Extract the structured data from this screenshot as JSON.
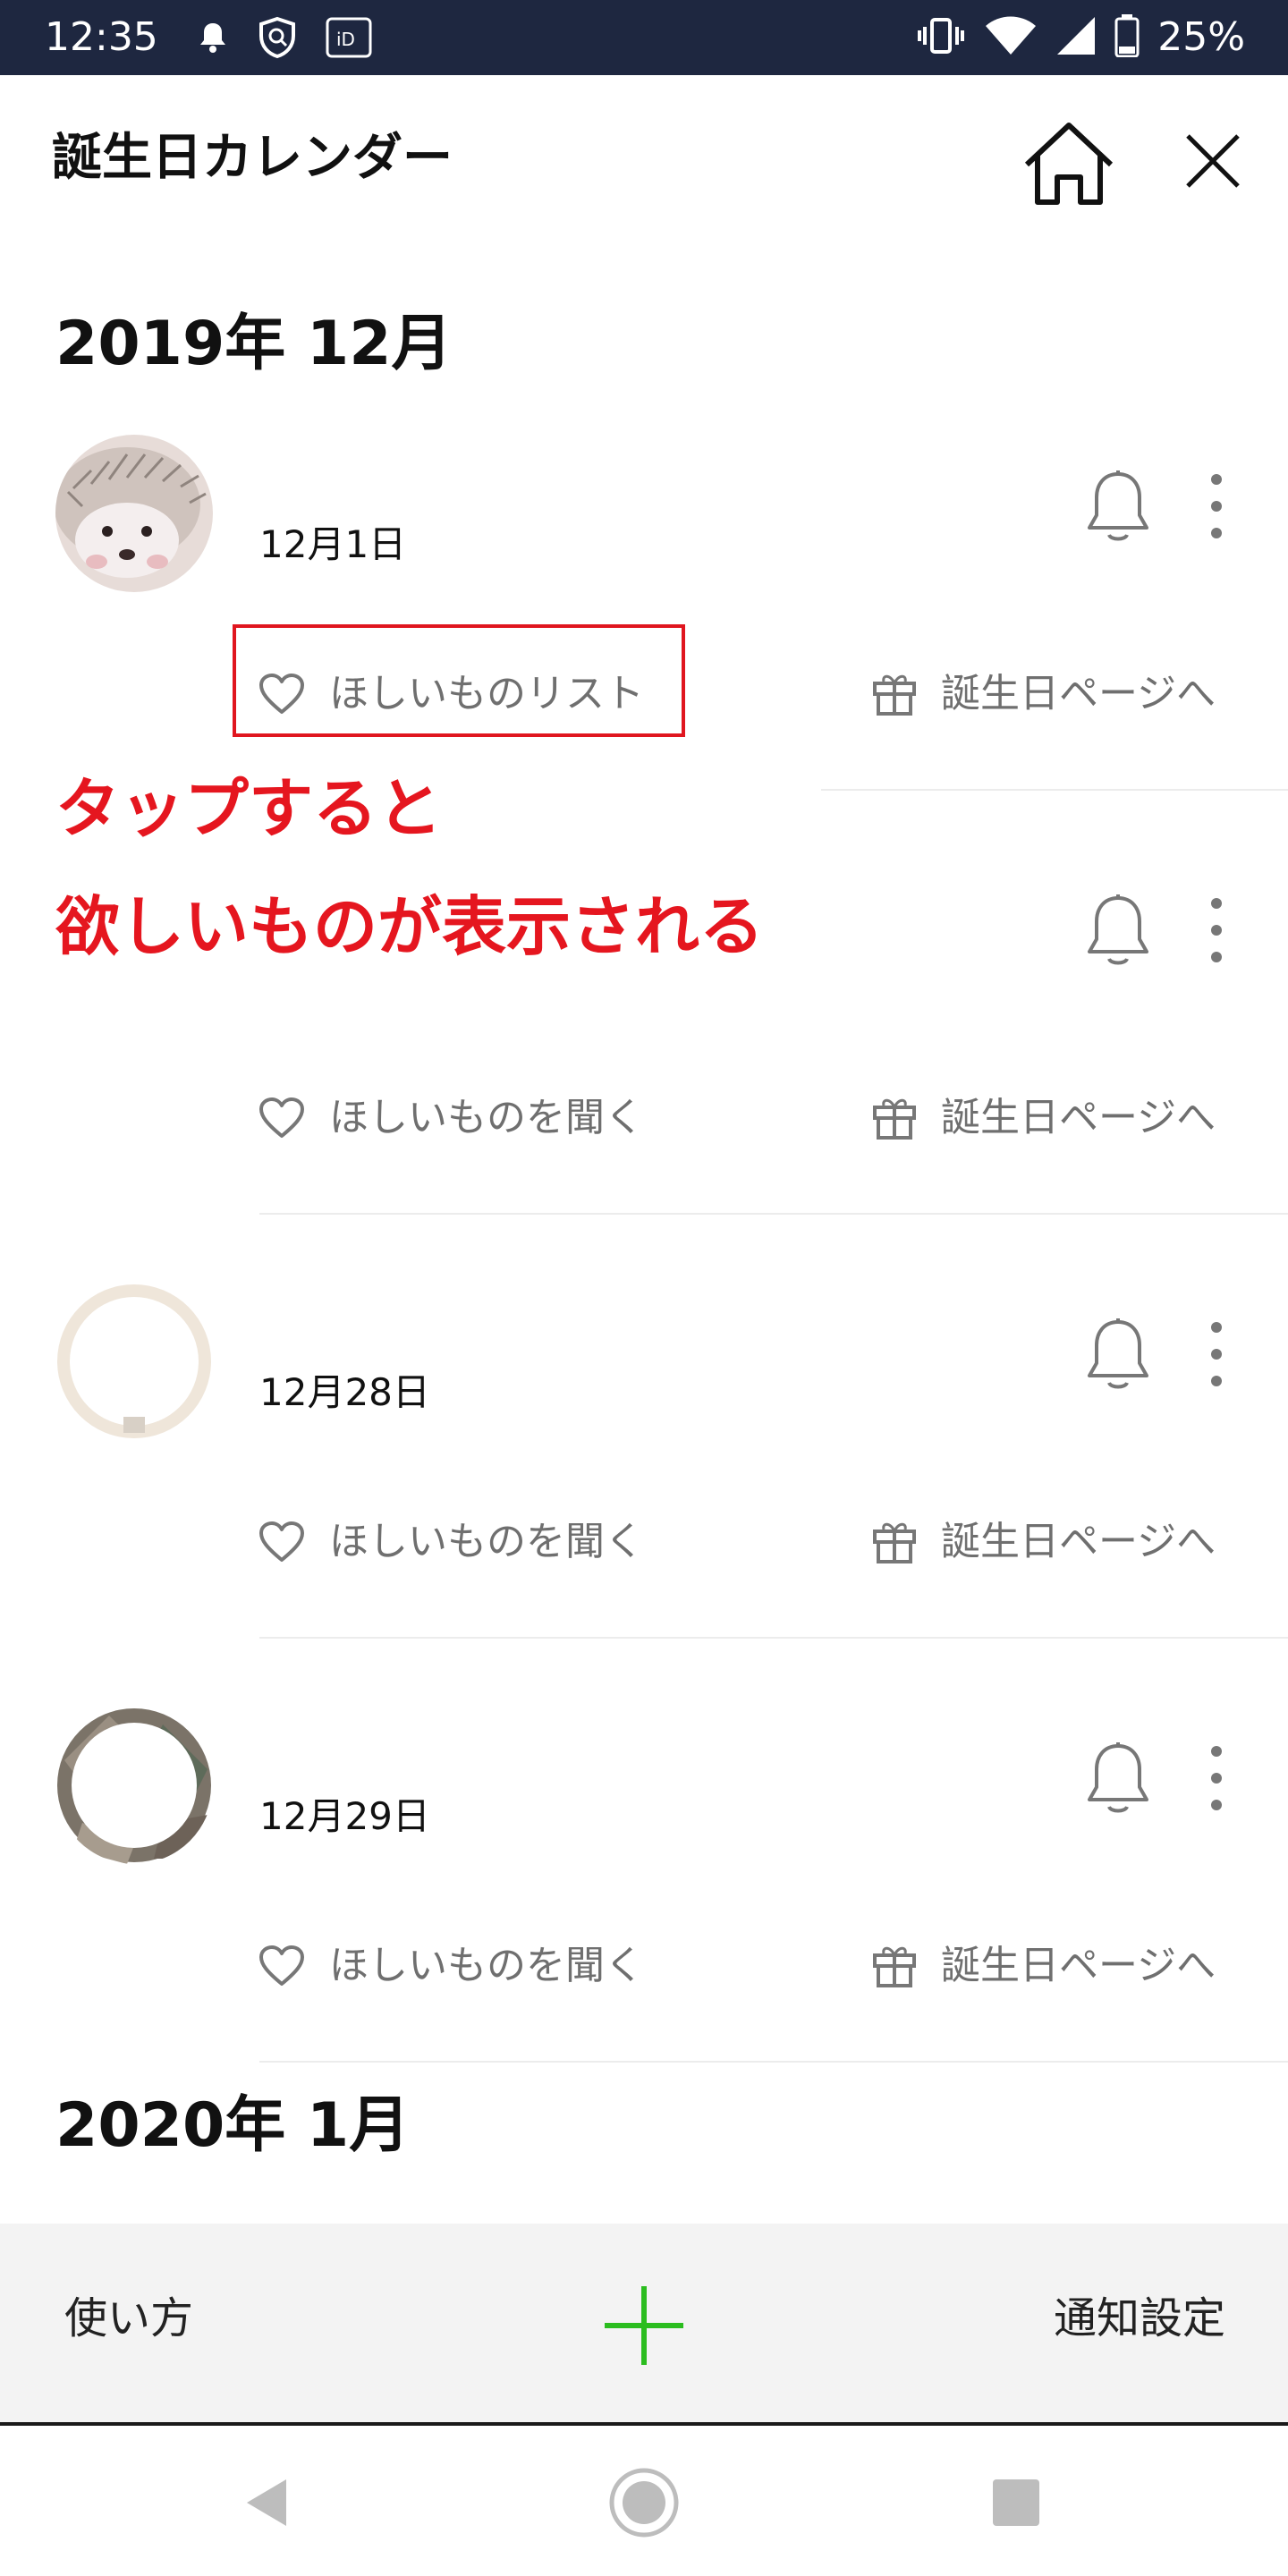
{
  "status_bar": {
    "time": "12:35",
    "battery": "25%",
    "left_icons": [
      "notification-icon",
      "shield-icon",
      "id-icon"
    ],
    "right_icons": [
      "vibrate-icon",
      "wifi-icon",
      "signal-icon",
      "battery-icon"
    ]
  },
  "header": {
    "title": "誕生日カレンダー"
  },
  "months": [
    {
      "label": "2019年 12月"
    },
    {
      "label": "2020年 1月"
    }
  ],
  "entries": [
    {
      "date": "12月1日",
      "left_action": "ほしいものリスト",
      "right_action": "誕生日ページへ"
    },
    {
      "date": "",
      "left_action": "ほしいものを聞く",
      "right_action": "誕生日ページへ"
    },
    {
      "date": "12月28日",
      "left_action": "ほしいものを聞く",
      "right_action": "誕生日ページへ"
    },
    {
      "date": "12月29日",
      "left_action": "ほしいものを聞く",
      "right_action": "誕生日ページへ"
    }
  ],
  "annotation": {
    "line1": "タップすると",
    "line2": "欲しいものが表示される",
    "color": "#e5161f"
  },
  "toolbar": {
    "left_label": "使い方",
    "right_label": "通知設定",
    "add_color": "#2bbd1f"
  }
}
